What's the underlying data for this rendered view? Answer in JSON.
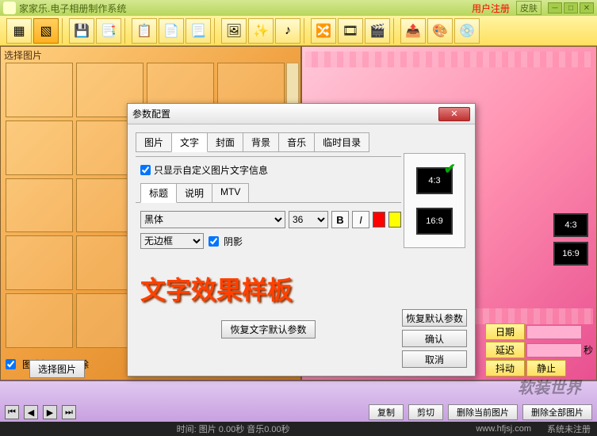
{
  "app": {
    "title": "家家乐.电子相册制作系统",
    "register": "用户注册",
    "skin": "皮肤"
  },
  "left": {
    "label": "选择图片",
    "chk": "图片插入后删除",
    "btn": "选择图片"
  },
  "right": {
    "ratios": [
      "4:3",
      "16:9"
    ],
    "date_btn": "日期",
    "delay_btn": "延迟",
    "sec": "秒",
    "shake_btn": "抖动",
    "stop_btn": "静止"
  },
  "timeline": {
    "copy": "复制",
    "cut": "剪切",
    "del_cur": "删除当前图片",
    "del_all": "删除全部图片"
  },
  "status": {
    "time": "时间: 图片 0.00秒 音乐0.00秒",
    "url": "www.hfjsj.com",
    "reg": "系统未注册"
  },
  "watermark": "软装世界",
  "dialog": {
    "title": "参数配置",
    "tabs": [
      "图片",
      "文字",
      "封面",
      "背景",
      "音乐",
      "临时目录"
    ],
    "active_tab": 1,
    "chk_custom": "只显示自定义图片文字信息",
    "subtabs": [
      "标题",
      "说明",
      "MTV"
    ],
    "active_sub": 0,
    "font": "黑体",
    "size": "36",
    "border": "无边框",
    "shadow": "阴影",
    "preview_text": "文字效果样板",
    "restore_text_btn": "恢复文字默认参数",
    "ratios": [
      "4:3",
      "16:9"
    ],
    "restore_btn": "恢复默认参数",
    "ok": "确认",
    "cancel": "取消"
  }
}
